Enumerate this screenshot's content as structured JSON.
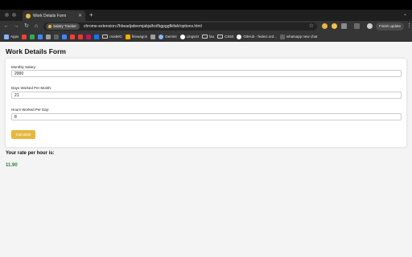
{
  "browser": {
    "tab": {
      "title": "Work Details Form"
    },
    "address_bar": {
      "extension_chip": "Salary Tracker",
      "url": "chrome-extension://hbeadpdeemjabjalhcifbgpggfkifah/options.html"
    },
    "finish_update_label": "Finish update",
    "bookmarks": [
      {
        "label": "Apps",
        "icon": "apps-grid-icon",
        "color": "#8ab4f8"
      },
      {
        "label": "",
        "icon": "gmail-icon",
        "color": "#ea4335"
      },
      {
        "label": "",
        "icon": "bookmark-icon",
        "color": "#34a853"
      },
      {
        "label": "",
        "icon": "bookmark-icon",
        "color": "#4285f4"
      },
      {
        "label": "",
        "icon": "bookmark-icon",
        "color": "#9e9e9e"
      },
      {
        "label": "",
        "icon": "bookmark-icon",
        "color": "#5f6368"
      },
      {
        "label": "",
        "icon": "bookmark-icon",
        "color": "#4285f4"
      },
      {
        "label": "",
        "icon": "bookmark-icon",
        "color": "#ea4335"
      },
      {
        "label": "",
        "icon": "bookmark-icon",
        "color": "#e53935"
      },
      {
        "label": "",
        "icon": "bookmark-icon",
        "color": "#c2185b"
      },
      {
        "label": "",
        "icon": "bookmark-icon",
        "color": "#1a73e8"
      },
      {
        "label": "modelC",
        "icon": "folder-icon",
        "color": "#cfcfcf"
      },
      {
        "label": "firewagon",
        "icon": "bookmark-icon",
        "color": "#f9ab00"
      },
      {
        "label": "",
        "icon": "bookmark-icon",
        "color": "#9e9e9e"
      },
      {
        "label": "Gemini",
        "icon": "gemini-icon",
        "color": "#8ab4f8"
      },
      {
        "label": "Lingvist",
        "icon": "lingvist-icon",
        "color": "#ffffff"
      },
      {
        "label": "fau",
        "icon": "folder-icon",
        "color": "#cfcfcf"
      },
      {
        "label": "CS50",
        "icon": "folder-icon",
        "color": "#cfcfcf"
      },
      {
        "label": "GitHub - fedeci.ord...",
        "icon": "github-icon",
        "color": "#ffffff"
      },
      {
        "label": "whatsapp new chat",
        "icon": "bookmark-icon",
        "color": "#5f6368"
      }
    ]
  },
  "page": {
    "title": "Work Details Form",
    "fields": [
      {
        "label": "Monthly Salary:",
        "value": "2000"
      },
      {
        "label": "Days Worked Per Month:",
        "value": "21"
      },
      {
        "label": "Hours Worked Per Day:",
        "value": "8"
      }
    ],
    "calculate_label": "Calculate",
    "result_heading": "Your rate per hour is:",
    "result_value": "11.90"
  },
  "colors": {
    "accent_button": "#e7b73e",
    "result_green": "#2e7d32"
  }
}
